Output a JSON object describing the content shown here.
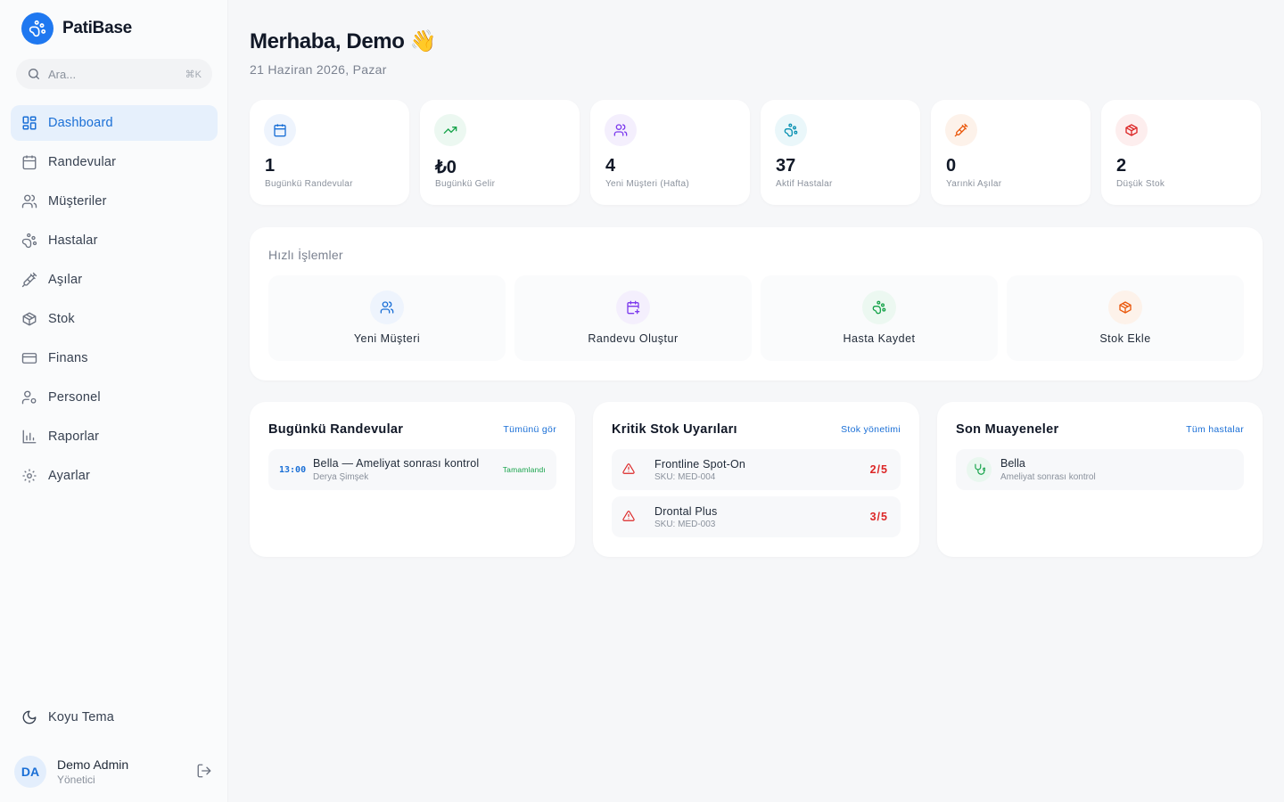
{
  "brand": {
    "name": "PatiBase",
    "icon": "paw-icon",
    "color": "#1f78f0"
  },
  "search": {
    "placeholder": "Ara...",
    "shortcut": "⌘K"
  },
  "sidebar": {
    "items": [
      {
        "label": "Dashboard",
        "icon": "dashboard-icon",
        "active": true
      },
      {
        "label": "Randevular",
        "icon": "calendar-icon"
      },
      {
        "label": "Müşteriler",
        "icon": "users-icon"
      },
      {
        "label": "Hastalar",
        "icon": "paw-icon"
      },
      {
        "label": "Aşılar",
        "icon": "syringe-icon"
      },
      {
        "label": "Stok",
        "icon": "box-icon"
      },
      {
        "label": "Finans",
        "icon": "credit-card-icon"
      },
      {
        "label": "Personel",
        "icon": "user-cog-icon"
      },
      {
        "label": "Raporlar",
        "icon": "bar-chart-icon"
      },
      {
        "label": "Ayarlar",
        "icon": "gear-icon"
      }
    ],
    "theme_toggle": "Koyu Tema"
  },
  "user": {
    "initials": "DA",
    "name": "Demo Admin",
    "role": "Yönetici"
  },
  "header": {
    "greeting": "Merhaba, Demo 👋",
    "date": "21 Haziran 2026, Pazar"
  },
  "stats": [
    {
      "value": "1",
      "label": "Bugünkü Randevular",
      "icon": "calendar-icon",
      "color": "#1a6fd6"
    },
    {
      "value": "₺0",
      "label": "Bugünkü Gelir",
      "icon": "trending-up-icon",
      "color": "#16a34a"
    },
    {
      "value": "4",
      "label": "Yeni Müşteri (Hafta)",
      "icon": "users-icon",
      "color": "#7c3aed"
    },
    {
      "value": "37",
      "label": "Aktif Hastalar",
      "icon": "paw-icon",
      "color": "#0891b2"
    },
    {
      "value": "0",
      "label": "Yarınki Aşılar",
      "icon": "syringe-icon",
      "color": "#ea580c"
    },
    {
      "value": "2",
      "label": "Düşük Stok",
      "icon": "box-icon",
      "color": "#dc2626"
    }
  ],
  "quick_actions": {
    "title": "Hızlı İşlemler",
    "items": [
      {
        "label": "Yeni Müşteri",
        "icon": "users-icon"
      },
      {
        "label": "Randevu Oluştur",
        "icon": "calendar-plus-icon"
      },
      {
        "label": "Hasta Kaydet",
        "icon": "paw-icon"
      },
      {
        "label": "Stok Ekle",
        "icon": "box-icon"
      }
    ]
  },
  "today_appointments": {
    "title": "Bugünkü Randevular",
    "link": "Tümünü gör",
    "items": [
      {
        "time": "13:00",
        "title": "Bella — Ameliyat sonrası kontrol",
        "owner": "Derya Şimşek",
        "status": "Tamamlandı"
      }
    ]
  },
  "stock_alerts": {
    "title": "Kritik Stok Uyarıları",
    "link": "Stok yönetimi",
    "items": [
      {
        "name": "Frontline Spot-On",
        "sku": "SKU: MED-004",
        "qty": "2/5"
      },
      {
        "name": "Drontal Plus",
        "sku": "SKU: MED-003",
        "qty": "3/5"
      }
    ]
  },
  "recent_exams": {
    "title": "Son Muayeneler",
    "link": "Tüm hastalar",
    "items": [
      {
        "name": "Bella",
        "note": "Ameliyat sonrası kontrol",
        "icon": "stethoscope-icon"
      }
    ]
  }
}
